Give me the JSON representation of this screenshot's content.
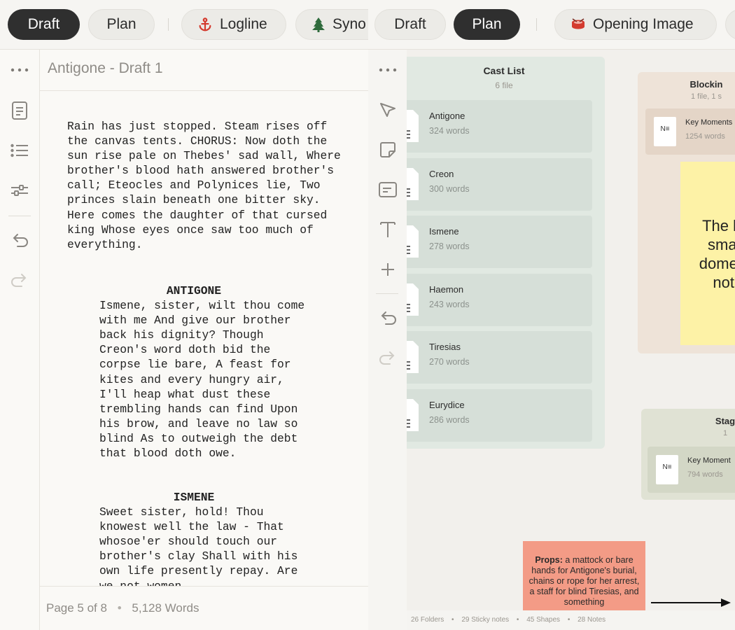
{
  "left": {
    "tabs": [
      {
        "label": "Draft",
        "active": true
      },
      {
        "label": "Plan",
        "active": false
      },
      {
        "label": "Logline",
        "icon": "anchor-icon"
      },
      {
        "label": "Syno",
        "icon": "tree-icon"
      }
    ],
    "sidebar_icons": [
      "more-icon",
      "document-icon",
      "list-icon",
      "sliders-icon",
      "undo-icon",
      "redo-icon"
    ],
    "doc_title": "Antigone - Draft 1",
    "script": {
      "action": "Rain has just stopped. Steam rises off the canvas tents. CHORUS: Now doth the sun rise pale on Thebes' sad wall, Where brother's blood hath answered brother's call; Eteocles and Polynices lie, Two princes slain beneath one bitter sky. Here comes the daughter of that cursed king Whose eyes once saw too much of everything.",
      "blocks": [
        {
          "character": "ANTIGONE",
          "dialogue": "Ismene, sister, wilt thou come with me And give our brother back his dignity? Though Creon's word doth bid the corpse lie bare, A feast for kites and every hungry air, I'll heap what dust these trembling hands can find Upon his brow, and leave no law so blind As to outweigh the debt that blood doth owe."
        },
        {
          "character": "ISMENE",
          "dialogue": "Sweet sister, hold! Thou knowest well the law - That whosoe'er should touch our brother's clay Shall with his own life presently repay. Are we not women"
        }
      ]
    },
    "status": {
      "page": "Page 5 of 8",
      "words": "5,128 Words"
    }
  },
  "right": {
    "tabs": [
      {
        "label": "Draft",
        "active": false
      },
      {
        "label": "Plan",
        "active": true
      },
      {
        "label": "Opening Image",
        "icon": "drum-icon"
      }
    ],
    "toolbar_icons": [
      "more-icon",
      "pointer-icon",
      "sticky-note-icon",
      "note-card-icon",
      "text-icon",
      "plus-icon",
      "undo-icon",
      "redo-icon"
    ],
    "cast_folder": {
      "title": "Cast List",
      "subtitle": "6 file",
      "files": [
        {
          "name": "Antigone",
          "words": "324 words"
        },
        {
          "name": "Creon",
          "words": "300 words"
        },
        {
          "name": "Ismene",
          "words": "278 words"
        },
        {
          "name": "Haemon",
          "words": "243 words"
        },
        {
          "name": "Tiresias",
          "words": "270 words"
        },
        {
          "name": "Eurydice",
          "words": "286 words"
        }
      ]
    },
    "blocking_folder": {
      "title": "Blockin",
      "subtitle": "1 file, 1 s",
      "file": {
        "name": "Key Moments",
        "words": "1254  words",
        "icon_text": "N"
      }
    },
    "sticky_yellow": [
      "The burial",
      "small an",
      "domestic b",
      "not cer"
    ],
    "staging_folder": {
      "title": "Stag",
      "subtitle": "1",
      "file": {
        "name": "Key Moment",
        "words": "794 words",
        "icon_text": "N"
      }
    },
    "props_note": {
      "label": "Props:",
      "text": " a mattock or bare hands for Antigone's burial, chains or rope for her arrest, a staff for blind Tiresias, and something"
    },
    "status": {
      "folders": "26 Folders",
      "sticky": "29 Sticky notes",
      "shapes": "45 Shapes",
      "notes": "28 Notes"
    }
  }
}
